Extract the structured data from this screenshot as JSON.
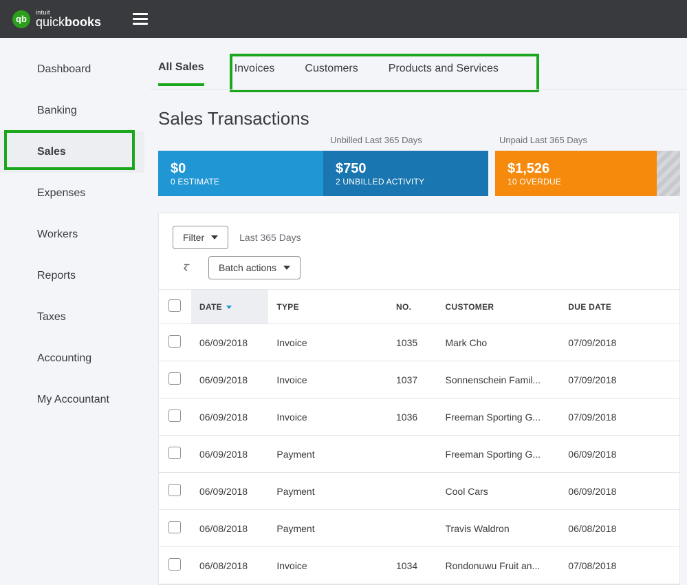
{
  "brand": {
    "intuit": "intuit",
    "name_light": "quick",
    "name_bold": "books",
    "icon_letters": "qb"
  },
  "sidebar": {
    "items": [
      {
        "label": "Dashboard"
      },
      {
        "label": "Banking"
      },
      {
        "label": "Sales",
        "active": true
      },
      {
        "label": "Expenses"
      },
      {
        "label": "Workers"
      },
      {
        "label": "Reports"
      },
      {
        "label": "Taxes"
      },
      {
        "label": "Accounting"
      },
      {
        "label": "My Accountant"
      }
    ]
  },
  "tabs": [
    {
      "label": "All Sales",
      "active": true
    },
    {
      "label": "Invoices"
    },
    {
      "label": "Customers"
    },
    {
      "label": "Products and Services"
    }
  ],
  "page_title": "Sales Transactions",
  "status": {
    "unbilled_label": "Unbilled Last 365 Days",
    "unpaid_label": "Unpaid Last 365 Days",
    "estimate": {
      "amount": "$0",
      "sub": "0 ESTIMATE"
    },
    "unbilled": {
      "amount": "$750",
      "sub": "2 UNBILLED ACTIVITY"
    },
    "overdue": {
      "amount": "$1,526",
      "sub": "10 OVERDUE"
    }
  },
  "toolbar": {
    "filter_label": "Filter",
    "range_label": "Last 365 Days",
    "batch_label": "Batch actions"
  },
  "table": {
    "headers": {
      "date": "DATE",
      "type": "TYPE",
      "no": "NO.",
      "customer": "CUSTOMER",
      "due": "DUE DATE"
    },
    "rows": [
      {
        "date": "06/09/2018",
        "type": "Invoice",
        "no": "1035",
        "customer": "Mark Cho",
        "due": "07/09/2018"
      },
      {
        "date": "06/09/2018",
        "type": "Invoice",
        "no": "1037",
        "customer": "Sonnenschein Famil...",
        "due": "07/09/2018"
      },
      {
        "date": "06/09/2018",
        "type": "Invoice",
        "no": "1036",
        "customer": "Freeman Sporting G...",
        "due": "07/09/2018"
      },
      {
        "date": "06/09/2018",
        "type": "Payment",
        "no": "",
        "customer": "Freeman Sporting G...",
        "due": "06/09/2018"
      },
      {
        "date": "06/09/2018",
        "type": "Payment",
        "no": "",
        "customer": "Cool Cars",
        "due": "06/09/2018"
      },
      {
        "date": "06/08/2018",
        "type": "Payment",
        "no": "",
        "customer": "Travis Waldron",
        "due": "06/08/2018"
      },
      {
        "date": "06/08/2018",
        "type": "Invoice",
        "no": "1034",
        "customer": "Rondonuwu Fruit an...",
        "due": "07/08/2018"
      }
    ]
  }
}
